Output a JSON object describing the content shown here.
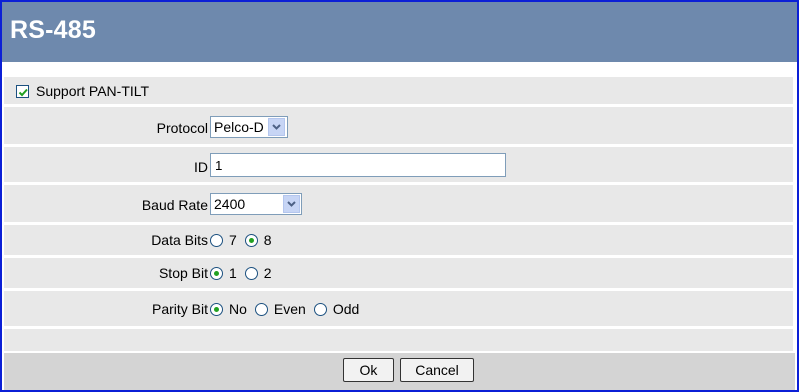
{
  "header": {
    "title": "RS-485"
  },
  "form": {
    "support_pantilt": {
      "label": "Support PAN-TILT",
      "checked": true
    },
    "protocol": {
      "label": "Protocol",
      "value": "Pelco-D"
    },
    "id": {
      "label": "ID",
      "value": "1"
    },
    "baud_rate": {
      "label": "Baud Rate",
      "value": "2400"
    },
    "data_bits": {
      "label": "Data Bits",
      "options": [
        "7",
        "8"
      ],
      "selected": "8"
    },
    "stop_bit": {
      "label": "Stop Bit",
      "options": [
        "1",
        "2"
      ],
      "selected": "1"
    },
    "parity_bit": {
      "label": "Parity Bit",
      "options": [
        "No",
        "Even",
        "Odd"
      ],
      "selected": "No"
    }
  },
  "buttons": {
    "ok": "Ok",
    "cancel": "Cancel"
  },
  "colors": {
    "header_bg": "#6e89ad",
    "row_bg": "#e8e8e8",
    "footer_bg": "#d4d4d4",
    "border": "#0b1fd6",
    "radio_dot": "#21a121"
  }
}
